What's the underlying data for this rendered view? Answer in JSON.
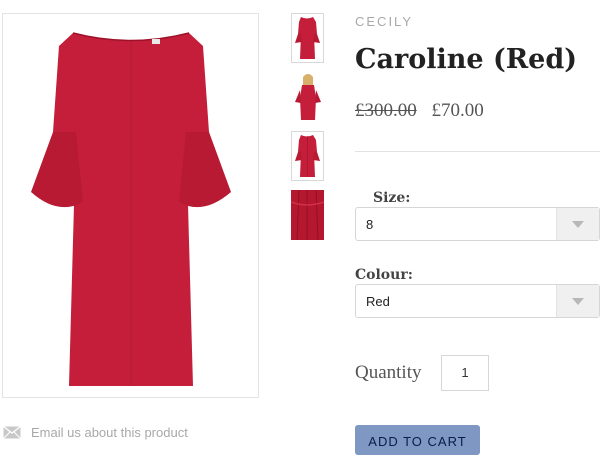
{
  "product": {
    "brand": "CECILY",
    "title": "Caroline (Red)",
    "price_original": "£300.00",
    "price_sale": "£70.00"
  },
  "options": {
    "size": {
      "label": "Size:",
      "value": "8"
    },
    "colour": {
      "label": "Colour:",
      "value": "Red"
    }
  },
  "quantity": {
    "label": "Quantity",
    "value": "1"
  },
  "actions": {
    "add_to_cart": "ADD TO CART"
  },
  "email": {
    "label": "Email us about this product",
    "icon": "envelope-icon"
  },
  "gallery": {
    "main_image": "red-bell-sleeve-dress",
    "thumbnails": [
      "dress-front",
      "dress-model",
      "dress-back",
      "fabric-detail"
    ]
  },
  "colors": {
    "dress": "#c41e3a",
    "button": "#7e97c3",
    "button_text": "#0b1d4a"
  }
}
